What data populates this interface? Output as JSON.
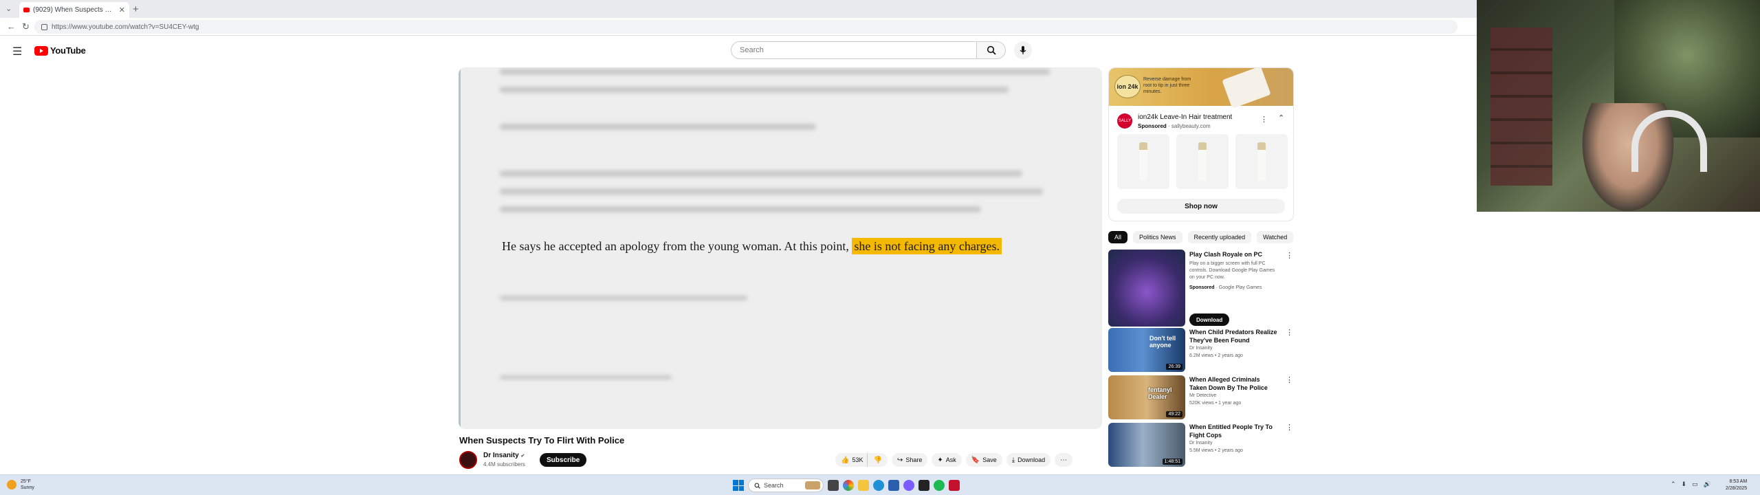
{
  "browser": {
    "tab_title": "(9029) When Suspects Try To Fli...",
    "url": "https://www.youtube.com/watch?v=SU4CEY-wtg"
  },
  "header": {
    "logo_text": "YouTube",
    "search_placeholder": "Search"
  },
  "video": {
    "caption_plain": "He says he accepted an apology from the young woman. At this point, ",
    "caption_highlight": "she is not facing any charges.",
    "title": "When Suspects Try To Flirt With Police",
    "channel": "Dr Insanity",
    "verified": "✔",
    "subscribers": "4.4M subscribers",
    "subscribe_label": "Subscribe",
    "likes": "53K",
    "share_label": "Share",
    "ask_label": "Ask",
    "save_label": "Save",
    "download_label": "Download"
  },
  "ad": {
    "banner_text": "Reverse damage from root to tip in just three minutes.",
    "badge_text": "ion 24k",
    "logo_text": "SALLY",
    "title": "ion24k Leave-In Hair treatment",
    "sponsored_label": "Sponsored",
    "domain": "sallybeauty.com",
    "shop_label": "Shop now"
  },
  "chips": [
    "All",
    "Politics News",
    "Recently uploaded",
    "Watched"
  ],
  "sponsored_rec": {
    "title": "Play Clash Royale on PC",
    "description": "Play on a bigger screen with full PC controls. Download Google Play Games on your PC now.",
    "sponsored_label": "Sponsored",
    "advertiser": "Google Play Games",
    "download_label": "Download"
  },
  "recommendations": [
    {
      "title": "When Child Predators Realize They've Been Found",
      "channel": "Dr Insanity",
      "meta": "6.2M views • 2 years ago",
      "duration": "26:39",
      "thumb_text": "Don't tell anyone"
    },
    {
      "title": "When Alleged Criminals Taken Down By The Police",
      "channel": "Mr Detective",
      "meta": "520K views • 1 year ago",
      "duration": "49:22",
      "thumb_text": "fentanyl Dealer"
    },
    {
      "title": "When Entitled People Try To Fight Cops",
      "channel": "Dr Insanity",
      "meta": "5.5M views • 2 years ago",
      "duration": "1:48:51",
      "thumb_text": ""
    }
  ],
  "taskbar": {
    "weather_temp": "25°F",
    "weather_desc": "Sunny",
    "search_placeholder": "Search",
    "time": "8:53 AM",
    "date": "2/28/2025"
  },
  "colors": {
    "caption_highlight": "#f5b800",
    "youtube_red": "#ff0000",
    "subscribe_bg": "#0f0f0f"
  }
}
